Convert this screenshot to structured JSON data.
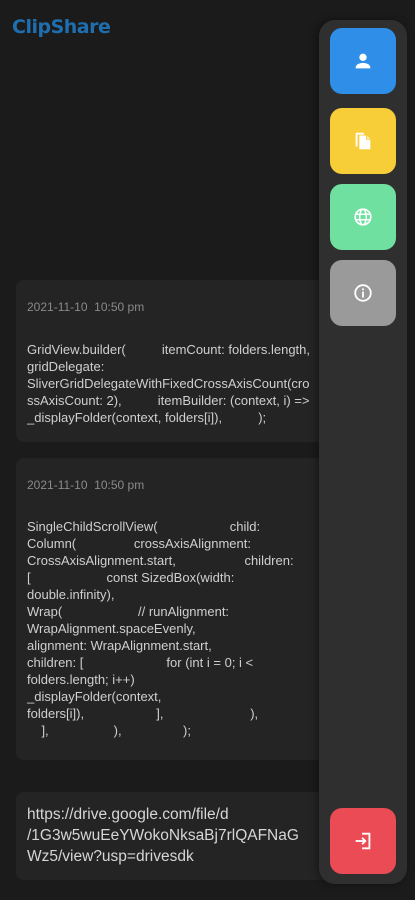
{
  "app": {
    "title": "ClipShare"
  },
  "clips": [
    {
      "timestamp": "2021-11-10  10:50 pm",
      "content": "GridView.builder(          itemCount: folders.length,\ngridDelegate:\nSliverGridDelegateWithFixedCrossAxisCount(cro\nssAxisCount: 2),          itemBuilder: (context, i) =>\n_displayFolder(context, folders[i]),          );"
    },
    {
      "timestamp": "2021-11-10  10:50 pm",
      "content": "SingleChildScrollView(                    child:\nColumn(                crossAxisAlignment:\nCrossAxisAlignment.start,                   children:\n[                     const SizedBox(width:\ndouble.infinity),\nWrap(                     // runAlignment:\nWrapAlignment.spaceEvenly,\nalignment: WrapAlignment.start,\nchildren: [                       for (int i = 0; i <\nfolders.length; i++)\n_displayFolder(context,\nfolders[i]),                    ],                        ),\n    ],                  ),                 );"
    },
    {
      "content": "https://drive.google.com/file/d\n/1G3w5wuEeYWokoNksaBj7rlQAFNaG\nWz5/view?usp=drivesdk"
    }
  ],
  "side_menu": {
    "buttons": [
      {
        "name": "profile-button",
        "icon": "person-icon",
        "color": "#2f8fe8"
      },
      {
        "name": "files-button",
        "icon": "file-copy-icon",
        "color": "#f7cd38"
      },
      {
        "name": "web-button",
        "icon": "globe-icon",
        "color": "#6fe0a0"
      },
      {
        "name": "info-button",
        "icon": "info-icon",
        "color": "#9a9a9a"
      },
      {
        "name": "logout-button",
        "icon": "exit-icon",
        "color": "#ea4b55"
      }
    ]
  }
}
